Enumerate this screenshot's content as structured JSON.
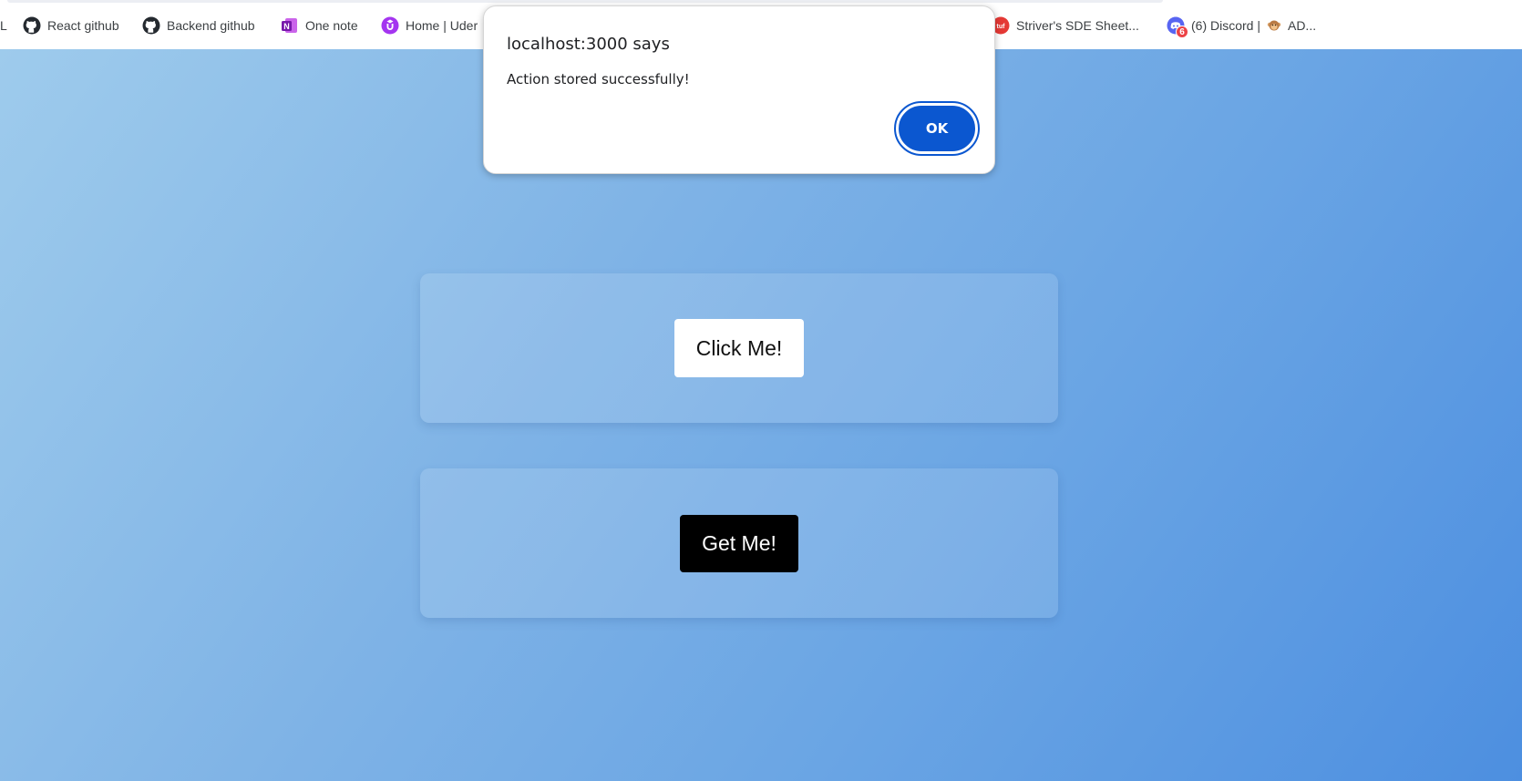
{
  "bookmarks": [
    {
      "label": "L",
      "icon": "none"
    },
    {
      "label": "React github",
      "icon": "github-icon"
    },
    {
      "label": "Backend github",
      "icon": "github-icon"
    },
    {
      "label": "One note",
      "icon": "onenote-icon"
    },
    {
      "label": "Home | Uder",
      "icon": "udemy-icon"
    },
    {
      "label": "Striver's SDE Sheet...",
      "icon": "tuf-icon"
    },
    {
      "label": "(6) Discord | ",
      "icon": "discord-icon",
      "badge": "6",
      "suffix": "AD..."
    }
  ],
  "page": {
    "card1_button": "Click Me!",
    "card2_button": "Get Me!"
  },
  "dialog": {
    "title": "localhost:3000 says",
    "message": "Action stored successfully!",
    "ok_label": "OK"
  },
  "colors": {
    "dialog_button": "#0b57d0",
    "gradient_start": "#9ecbec",
    "gradient_end": "#4d8fe0"
  }
}
